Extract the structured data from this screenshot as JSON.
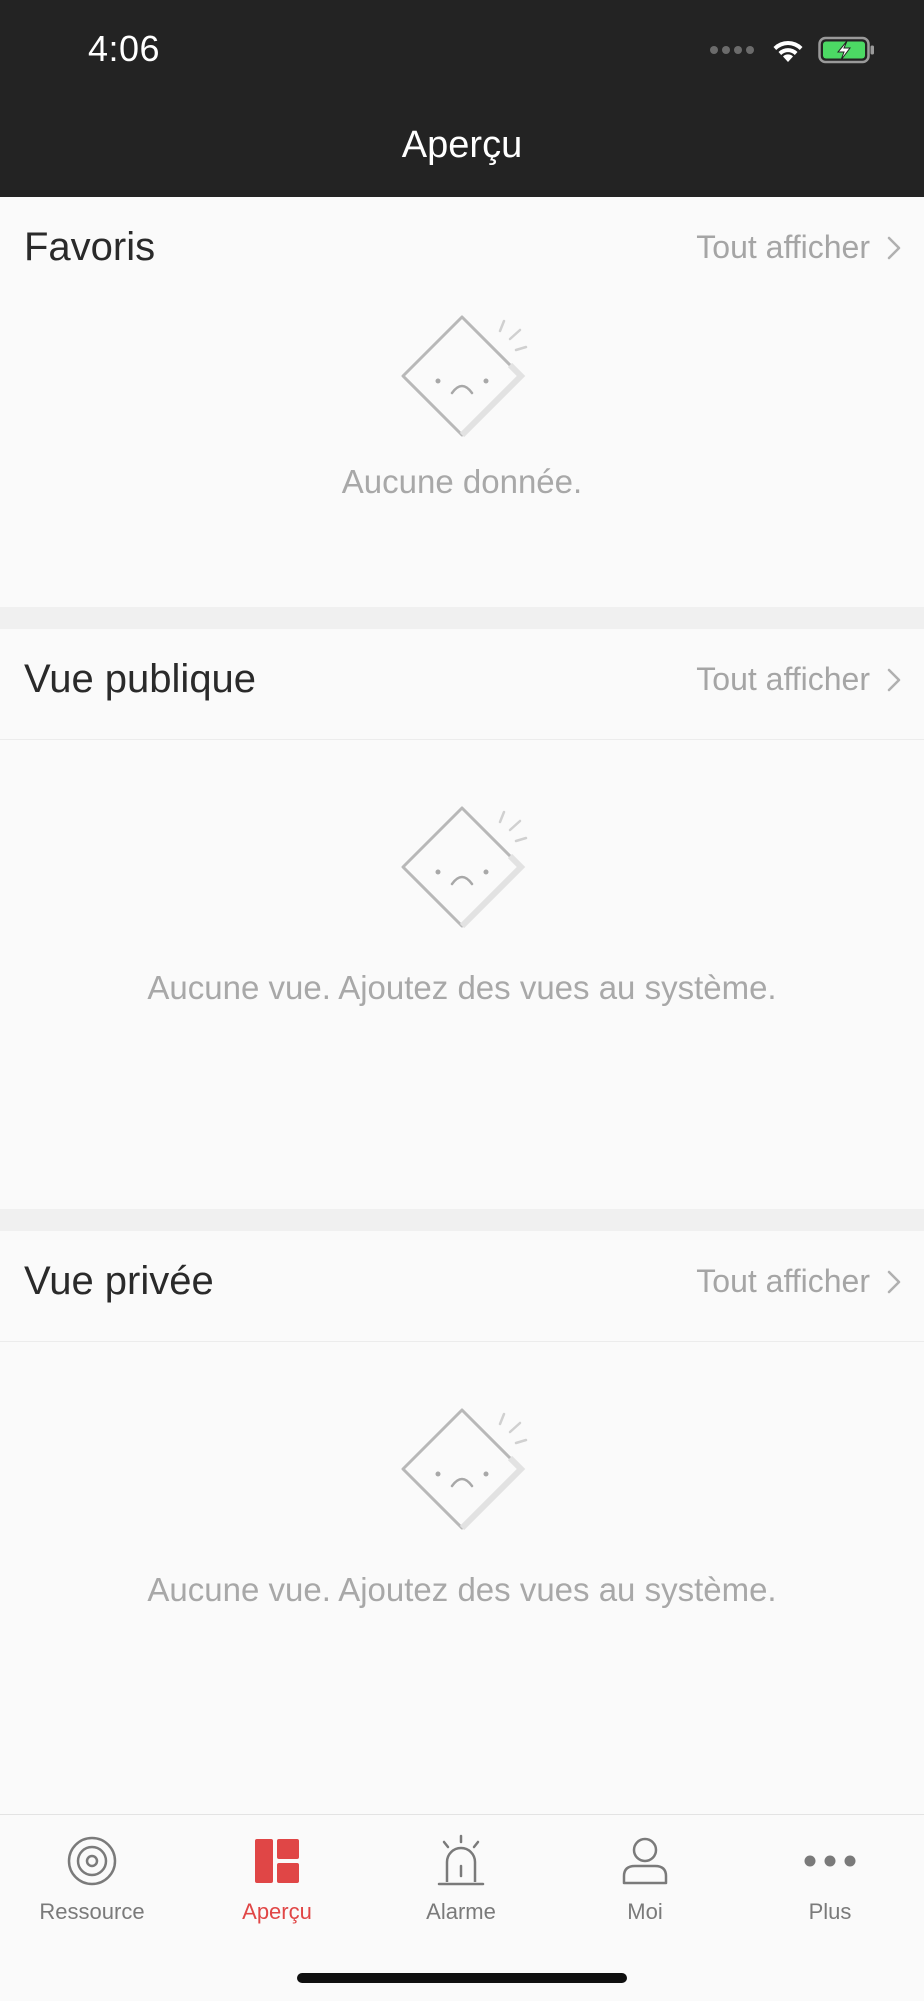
{
  "status_bar": {
    "time": "4:06"
  },
  "nav": {
    "title": "Aperçu"
  },
  "sections": {
    "favorites": {
      "title": "Favoris",
      "see_all": "Tout afficher",
      "empty_text": "Aucune donnée."
    },
    "public_view": {
      "title": "Vue publique",
      "see_all": "Tout afficher",
      "empty_text": "Aucune vue. Ajoutez des vues au système."
    },
    "private_view": {
      "title": "Vue privée",
      "see_all": "Tout afficher",
      "empty_text": "Aucune vue. Ajoutez des vues au système."
    }
  },
  "tabbar": {
    "tabs": [
      {
        "label": "Ressource",
        "icon": "resource-icon",
        "active": false
      },
      {
        "label": "Aperçu",
        "icon": "overview-icon",
        "active": true
      },
      {
        "label": "Alarme",
        "icon": "alarm-icon",
        "active": false
      },
      {
        "label": "Moi",
        "icon": "user-icon",
        "active": false
      },
      {
        "label": "Plus",
        "icon": "more-icon",
        "active": false
      }
    ]
  },
  "colors": {
    "accent": "#e04646",
    "header_bg": "#232323",
    "battery_green": "#4cd964"
  }
}
